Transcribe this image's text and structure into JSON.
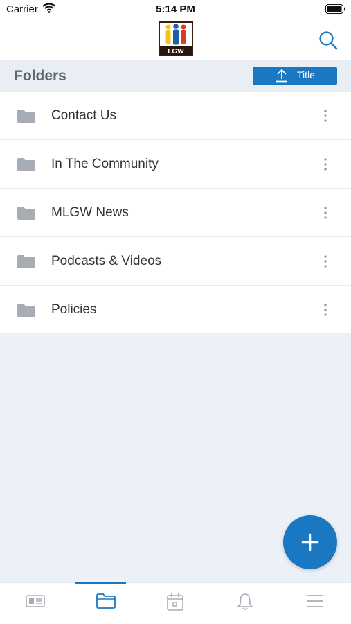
{
  "status_bar": {
    "carrier": "Carrier",
    "time": "5:14 PM"
  },
  "header": {
    "logo_text": "LGW",
    "search_icon": "search-icon"
  },
  "folders_bar": {
    "title": "Folders",
    "sort_label": "Title",
    "sort_icon": "arrow-up-icon"
  },
  "folders": [
    {
      "label": "Contact Us"
    },
    {
      "label": "In The Community"
    },
    {
      "label": "MLGW News"
    },
    {
      "label": "Podcasts & Videos"
    },
    {
      "label": "Policies"
    }
  ],
  "fab": {
    "icon": "plus-icon"
  },
  "tabs": [
    {
      "name": "news",
      "icon": "newspaper-icon",
      "active": false
    },
    {
      "name": "folders",
      "icon": "folder-icon",
      "active": true
    },
    {
      "name": "calendar",
      "icon": "calendar-icon",
      "active": false
    },
    {
      "name": "notifications",
      "icon": "bell-icon",
      "active": false
    },
    {
      "name": "menu",
      "icon": "hamburger-icon",
      "active": false
    }
  ],
  "colors": {
    "accent": "#1a78c2",
    "background": "#ecf1f7",
    "icon_gray": "#a7adb5"
  }
}
